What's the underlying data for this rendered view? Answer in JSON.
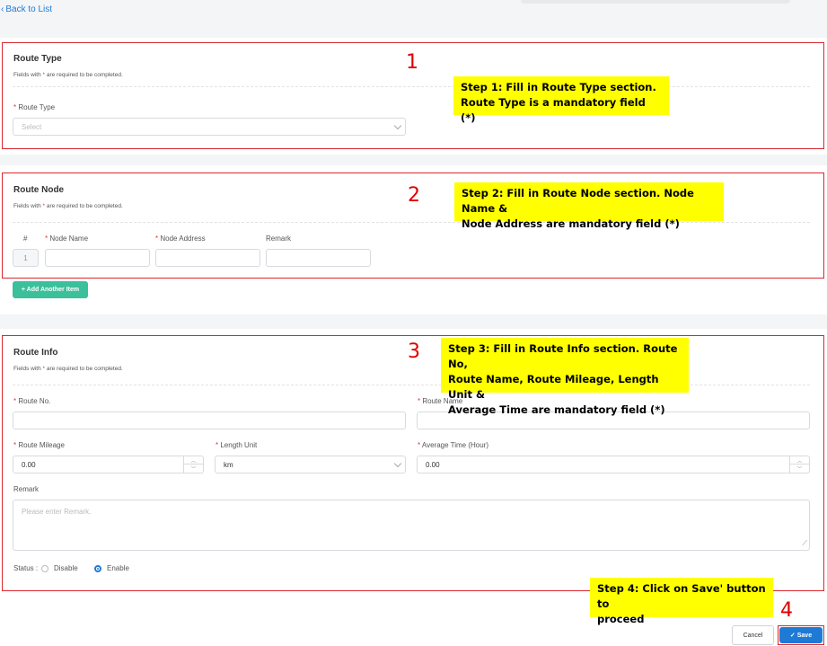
{
  "nav": {
    "back_label": "Back to List",
    "back_icon": "chevron-left-icon"
  },
  "route_type": {
    "title": "Route Type",
    "note_prefix": "Fields with ",
    "note_star": "*",
    "note_suffix": " are required to be completed.",
    "field_label": "Route Type",
    "placeholder": "Select"
  },
  "route_node": {
    "title": "Route Node",
    "note_prefix": "Fields with ",
    "note_star": "*",
    "note_suffix": " are required to be completed.",
    "col_hash": "#",
    "col_node_name": "Node Name",
    "col_node_address": "Node Address",
    "col_remark": "Remark",
    "row_index": "1",
    "add_button": "+ Add Another Item"
  },
  "route_info": {
    "title": "Route Info",
    "note_prefix": "Fields with ",
    "note_star": "*",
    "note_suffix": " are required to be completed.",
    "route_no_label": "Route No.",
    "route_name_label": "Route Name",
    "mileage_label": "Route Mileage",
    "mileage_value": "0.00",
    "length_unit_label": "Length Unit",
    "length_unit_value": "km",
    "avg_time_label": "Average Time (Hour)",
    "avg_time_value": "0.00",
    "remark_label": "Remark",
    "remark_placeholder": "Please enter Remark.",
    "status_label": "Status :",
    "status_options": [
      "Disable",
      "Enable"
    ],
    "status_selected": "Enable"
  },
  "footer": {
    "cancel_label": "Cancel",
    "save_label": "Save",
    "save_icon": "check-icon"
  },
  "callouts": {
    "step1": [
      "Step 1: Fill in Route Type section.",
      "Route Type is a mandatory field (*)"
    ],
    "step2": [
      "Step 2: Fill in Route Node section. Node Name &",
      "Node Address are mandatory field (*)"
    ],
    "step3": [
      "Step 3: Fill in Route Info section. Route No,",
      "Route Name, Route Mileage, Length Unit &",
      "Average Time are mandatory field (*)"
    ],
    "step4": [
      "Step 4: Click on Save' button to",
      "proceed"
    ]
  },
  "step_numbers": [
    "1",
    "2",
    "3",
    "4"
  ],
  "colors": {
    "accent": "#1f7ad6",
    "add_button": "#3cbf9b",
    "required": "#e4393c",
    "callout": "#ffff00",
    "annotation": "#d9282f"
  }
}
